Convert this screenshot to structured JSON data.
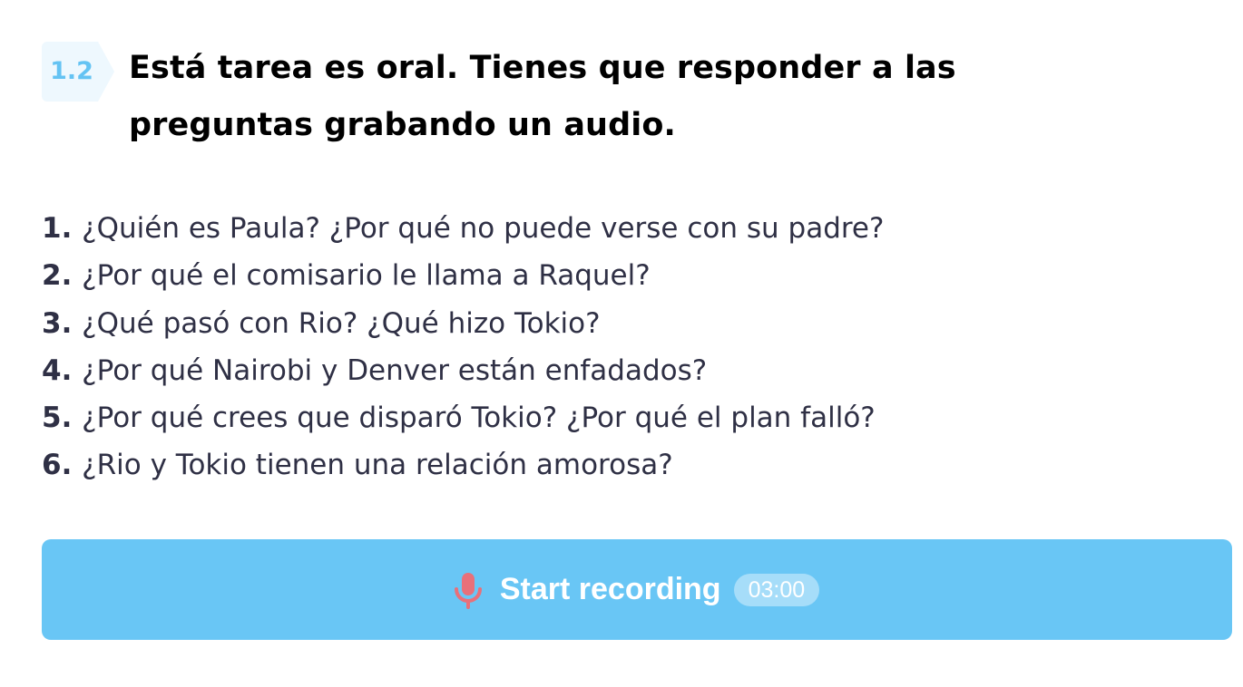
{
  "task": {
    "number": "1.2",
    "title": "Está tarea es oral. Tienes que responder a las preguntas grabando un audio."
  },
  "questions": [
    {
      "num": "1.",
      "text": "¿Quién es Paula? ¿Por qué no puede verse con su padre?"
    },
    {
      "num": "2.",
      "text": "¿Por qué el comisario le llama a Raquel?"
    },
    {
      "num": "3.",
      "text": "¿Qué pasó con Rio? ¿Qué hizo Tokio?"
    },
    {
      "num": "4.",
      "text": "¿Por qué Nairobi y Denver están enfadados?"
    },
    {
      "num": "5.",
      "text": "¿Por qué crees que disparó Tokio? ¿Por qué el plan falló?"
    },
    {
      "num": "6.",
      "text": "¿Rio y Tokio tienen una relación amorosa?"
    }
  ],
  "recorder": {
    "label": "Start recording",
    "time_limit": "03:00",
    "icon": "microphone-icon"
  },
  "colors": {
    "accent": "#69c6f5",
    "badge_bg": "#eef8fe",
    "badge_text": "#64c3f3",
    "mic": "#e8707a",
    "timer_bg": "#a6ddf9",
    "text": "#2f3045"
  }
}
